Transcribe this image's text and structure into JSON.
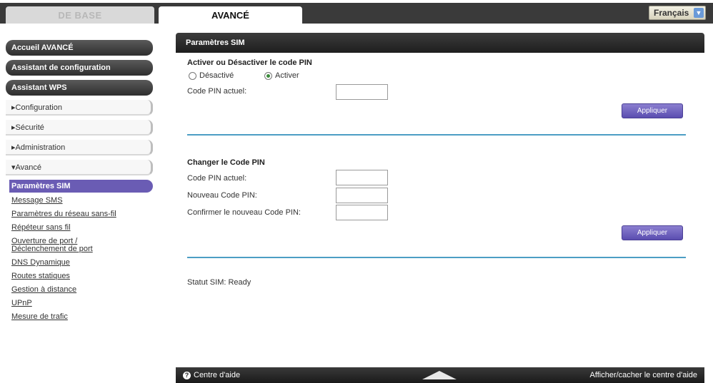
{
  "tabs": {
    "basic": "DE BASE",
    "advanced": "AVANCÉ"
  },
  "language": {
    "selected": "Français"
  },
  "sidebar": {
    "buttons": [
      "Accueil AVANCÉ",
      "Assistant de configuration",
      "Assistant WPS"
    ],
    "menus": [
      "▸Configuration",
      "▸Sécurité",
      "▸Administration",
      "▾Avancé"
    ],
    "active_item": "Paramètres SIM",
    "sub_items": [
      "Message SMS",
      "Paramètres du réseau sans-fil",
      "Répéteur sans fil",
      "Ouverture de port / Déclenchement de port",
      "DNS Dynamique",
      "Routes statiques",
      "Gestion à distance",
      "UPnP",
      "Mesure de trafic"
    ]
  },
  "panel": {
    "title": "Paramètres SIM",
    "pin_section": {
      "title": "Activer ou Désactiver le code PIN",
      "option_off": "Désactivé",
      "option_on": "Activer",
      "selected": "Activer",
      "current_pin_label": "Code PIN actuel:",
      "current_pin_value": "",
      "apply": "Appliquer"
    },
    "change_section": {
      "title": "Changer le Code PIN",
      "current_pin_label": "Code PIN actuel:",
      "new_pin_label": "Nouveau Code PIN:",
      "confirm_pin_label": "Confirmer le nouveau Code PIN:",
      "apply": "Appliquer"
    },
    "status": "Statut SIM: Ready"
  },
  "footer": {
    "help_center": "Centre d'aide",
    "toggle_help": "Afficher/cacher le centre d'aide"
  }
}
